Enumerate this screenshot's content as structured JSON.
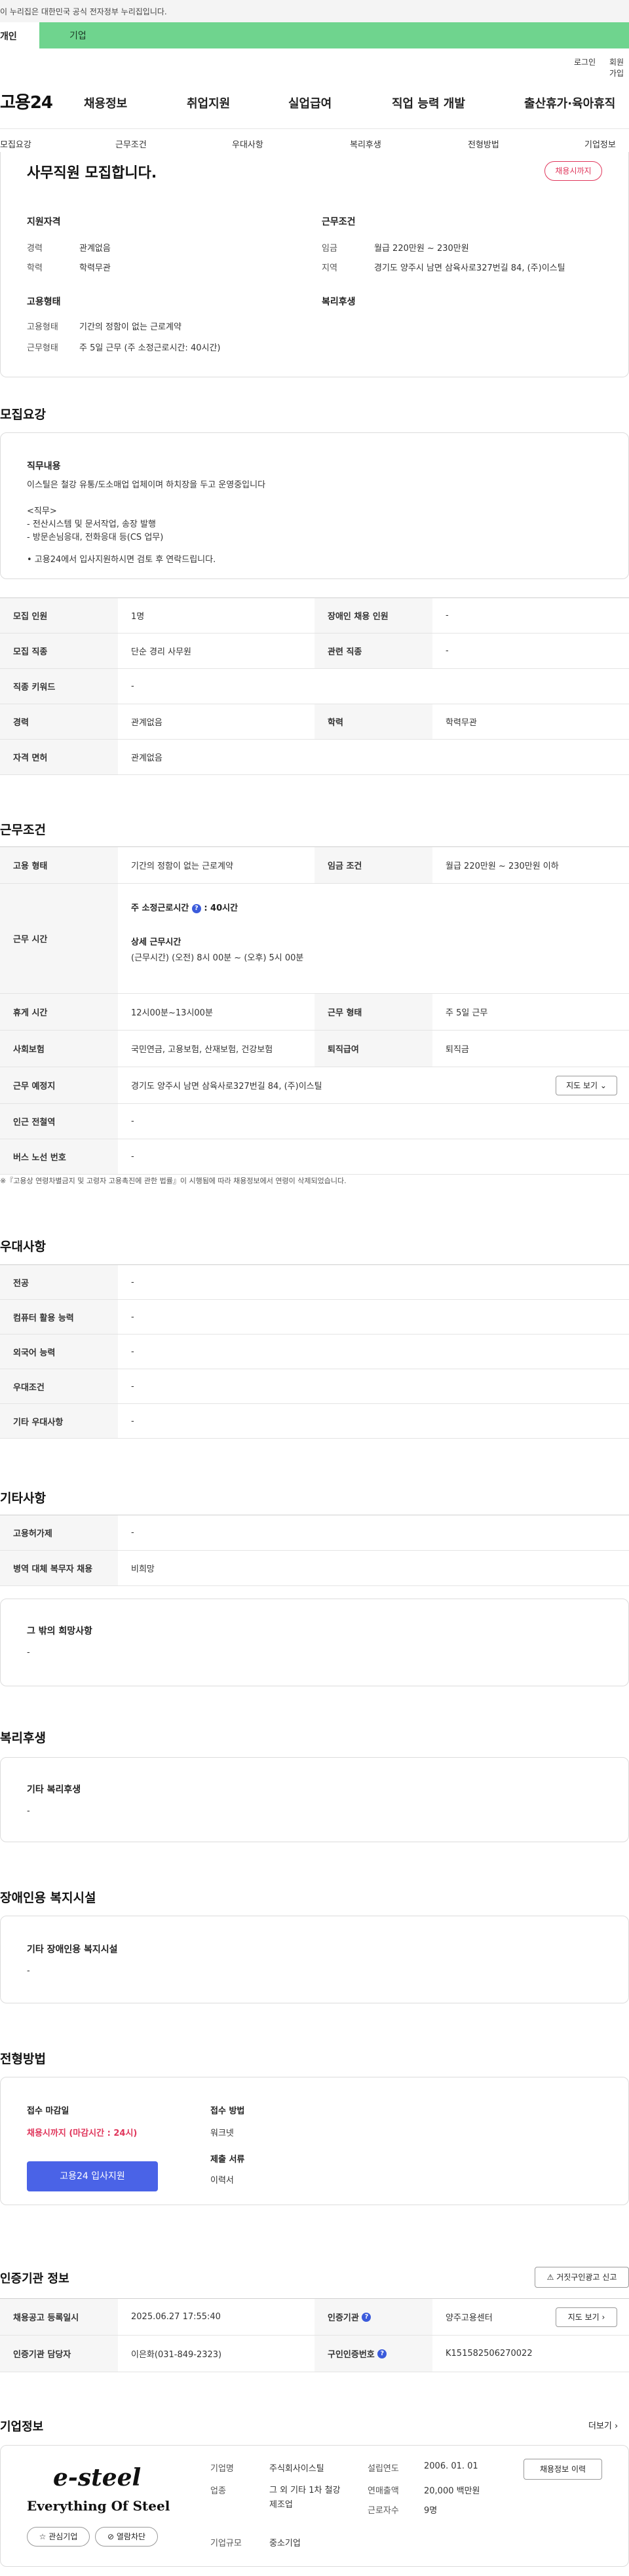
{
  "gov_banner": "이 누리집은 대한민국 공식 전자정부 누리집입니다.",
  "user_tabs": {
    "person": "개인",
    "business": "기업"
  },
  "util_links": {
    "login": "로그인",
    "join": "회원가입"
  },
  "logo": "고용24",
  "gnb": [
    "채용정보",
    "취업지원",
    "실업급여",
    "직업 능력 개발",
    "출산휴가·육아휴직"
  ],
  "subnav": [
    "모집요강",
    "근무조건",
    "우대사항",
    "복리후생",
    "전형방법",
    "기업정보"
  ],
  "summary": {
    "title": "사무직원 모집합니다.",
    "badge": "채용시까지",
    "qual_heading": "지원자격",
    "career_label": "경력",
    "career_value": "관계없음",
    "edu_label": "학력",
    "edu_value": "학력무관",
    "cond_heading": "근무조건",
    "wage_label": "임금",
    "wage_value": "월급 220만원 ~ 230만원",
    "area_label": "지역",
    "area_value": "경기도 양주시 남면 삼육사로327번길 84, (주)이스틸",
    "emp_heading": "고용형태",
    "emp_type_label": "고용형태",
    "emp_type_value": "기간의 정함이 없는 근로계약",
    "work_label": "근무형태",
    "work_value": "주 5일 근무 (주 소정근로시간: 40시간)",
    "welfare_heading": "복리후생"
  },
  "recruit": {
    "heading": "모집요강",
    "duty_heading": "직무내용",
    "duty_lines": [
      "이스틸은 철강 유통/도소매업 업체이며 하치장을 두고 운영중입니다",
      "",
      "<직무>",
      "- 전산시스템 및 문서작업, 송장 발행",
      "- 방문손님응대, 전화응대 등(CS 업무)",
      "",
      "• 고용24에서 입사지원하시면 검토 후 연락드립니다."
    ],
    "rows": [
      {
        "k1": "모집 인원",
        "v1": "1명",
        "k2": "장애인 채용 인원",
        "v2": "-"
      },
      {
        "k1": "모집 직종",
        "v1": "단순 경리 사무원",
        "k2": "관련 직종",
        "v2": "-"
      },
      {
        "k1": "직종 키워드",
        "v1": "-"
      },
      {
        "k1": "경력",
        "v1": "관계없음",
        "k2": "학력",
        "v2": "학력무관"
      },
      {
        "k1": "자격 면허",
        "v1": "관계없음"
      }
    ]
  },
  "work": {
    "heading": "근무조건",
    "emp_type_label": "고용 형태",
    "emp_type_value": "기간의 정함이 없는 근로계약",
    "wage_label": "임금 조건",
    "wage_value": "월급 220만원 ~ 230만원 이하",
    "hours_label": "근무 시간",
    "hours_title": "주 소정근로시간",
    "hours_value": ": 40시간",
    "detail_title": "상세 근무시간",
    "detail_value": "(근무시간) (오전) 8시 00분 ~ (오후) 5시 00분",
    "rest_label": "휴게 시간",
    "rest_value": "12시00분~13시00분",
    "worktype_label": "근무 형태",
    "worktype_value": "주 5일 근무",
    "insurance_label": "사회보험",
    "insurance_value": "국민연금, 고용보험, 산재보험, 건강보험",
    "severance_label": "퇴직급여",
    "severance_value": "퇴직금",
    "place_label": "근무 예정지",
    "place_value": "경기도 양주시 남면 삼육사로327번길 84, (주)이스틸",
    "map_btn": "지도 보기",
    "station_label": "인근 전철역",
    "station_value": "-",
    "bus_label": "버스 노선 번호",
    "bus_value": "-",
    "note": "※『고용상 연령차별금지 및 고령자 고용촉진에 관한 법률』이 시행됨에 따라 채용정보에서 연령이 삭제되었습니다."
  },
  "pref": {
    "heading": "우대사항",
    "rows": [
      {
        "k": "전공",
        "v": "-"
      },
      {
        "k": "컴퓨터 활용 능력",
        "v": "-"
      },
      {
        "k": "외국어 능력",
        "v": "-"
      },
      {
        "k": "우대조건",
        "v": "-"
      },
      {
        "k": "기타 우대사항",
        "v": "-"
      }
    ]
  },
  "etc": {
    "heading": "기타사항",
    "rows": [
      {
        "k": "고용허가제",
        "v": "-"
      },
      {
        "k": "병역 대체 복무자 채용",
        "v": "비희망"
      }
    ],
    "wish_heading": "그 밖의 희망사항",
    "wish_value": "-"
  },
  "welfare": {
    "heading": "복리후생",
    "box_heading": "기타 복리후생",
    "box_value": "-"
  },
  "disabled": {
    "heading": "장애인용 복지시설",
    "box_heading": "기타 장애인용 복지시설",
    "box_value": "-"
  },
  "process": {
    "heading": "전형방법",
    "deadline_label": "접수 마감일",
    "deadline_value": "채용시까지 (마감시간 : 24시)",
    "apply_btn": "고용24 입사지원",
    "method_label": "접수 방법",
    "method_value": "워크넷",
    "docs_label": "제출 서류",
    "docs_value": "이력서"
  },
  "cert": {
    "heading": "인증기관 정보",
    "report_btn": "거짓구인광고 신고",
    "reg_label": "채용공고 등록일시",
    "reg_value": "2025.06.27 17:55:40",
    "org_label": "인증기관",
    "org_value": "양주고용센터",
    "map_btn": "지도 보기",
    "manager_label": "인증기관 담당자",
    "manager_value": "이은화(031-849-2323)",
    "cert_no_label": "구인인증번호",
    "cert_no_value": "K151582506270022"
  },
  "company": {
    "heading": "기업정보",
    "more": "더보기",
    "logo_text": "e-steel",
    "slogan": "Everything Of Steel",
    "fav_btn": "관심기업",
    "block_btn": "열람차단",
    "name_label": "기업명",
    "name_value": "주식회사이스틸",
    "industry_label": "업종",
    "industry_value": "그 외 기타 1차 철강 제조업",
    "size_label": "기업규모",
    "size_value": "중소기업",
    "founded_label": "설립연도",
    "founded_value": "2006. 01. 01",
    "sales_label": "연매출액",
    "sales_value": "20,000 백만원",
    "employees_label": "근로자수",
    "employees_value": "9명",
    "history_btn": "채용정보 이력"
  }
}
